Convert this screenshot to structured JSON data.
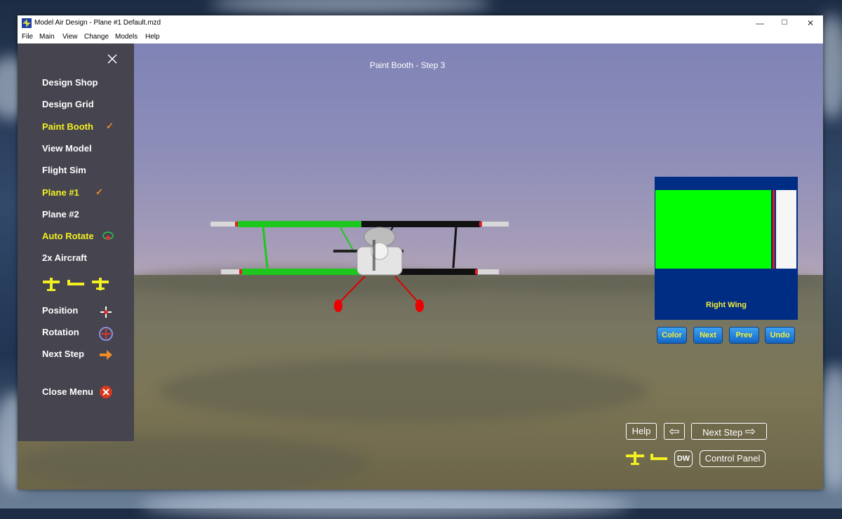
{
  "window": {
    "title": "Model Air Design - Plane #1  Default.mzd",
    "controls": {
      "minimize": "—",
      "maximize": "☐",
      "close": "✕"
    }
  },
  "menubar": [
    "File",
    "Main",
    "View",
    "Change",
    "Models",
    "Help"
  ],
  "viewport_title": "Paint Booth  -  Step 3",
  "sidebar": {
    "items": {
      "design_shop": "Design Shop",
      "design_grid": "Design Grid",
      "paint_booth": "Paint Booth",
      "view_model": "View Model",
      "flight_sim": "Flight Sim",
      "plane1": "Plane #1",
      "plane2": "Plane #2",
      "auto_rotate": "Auto Rotate",
      "x2_aircraft": "2x Aircraft",
      "position": "Position",
      "rotation": "Rotation",
      "next_step": "Next Step",
      "close_menu": "Close Menu"
    },
    "check_mark": "✓"
  },
  "paint_panel": {
    "label": "Right Wing",
    "colors": {
      "bg": "#002d84",
      "swatch": "#00ff00",
      "stripe": "#e01b1b",
      "tip": "#f6f6f6"
    }
  },
  "paint_buttons": {
    "color": "Color",
    "next": "Next",
    "prev": "Prev",
    "undo": "Undo"
  },
  "bottom_controls": {
    "help": "Help",
    "back_arrow": "⇦",
    "next_step": "Next Step",
    "next_arrow": "⇨",
    "dw": "DW",
    "control_panel": "Control Panel"
  },
  "accent_colors": {
    "highlight": "#f2ef22",
    "check": "#f08a2a",
    "sidebar": "#45444f"
  }
}
